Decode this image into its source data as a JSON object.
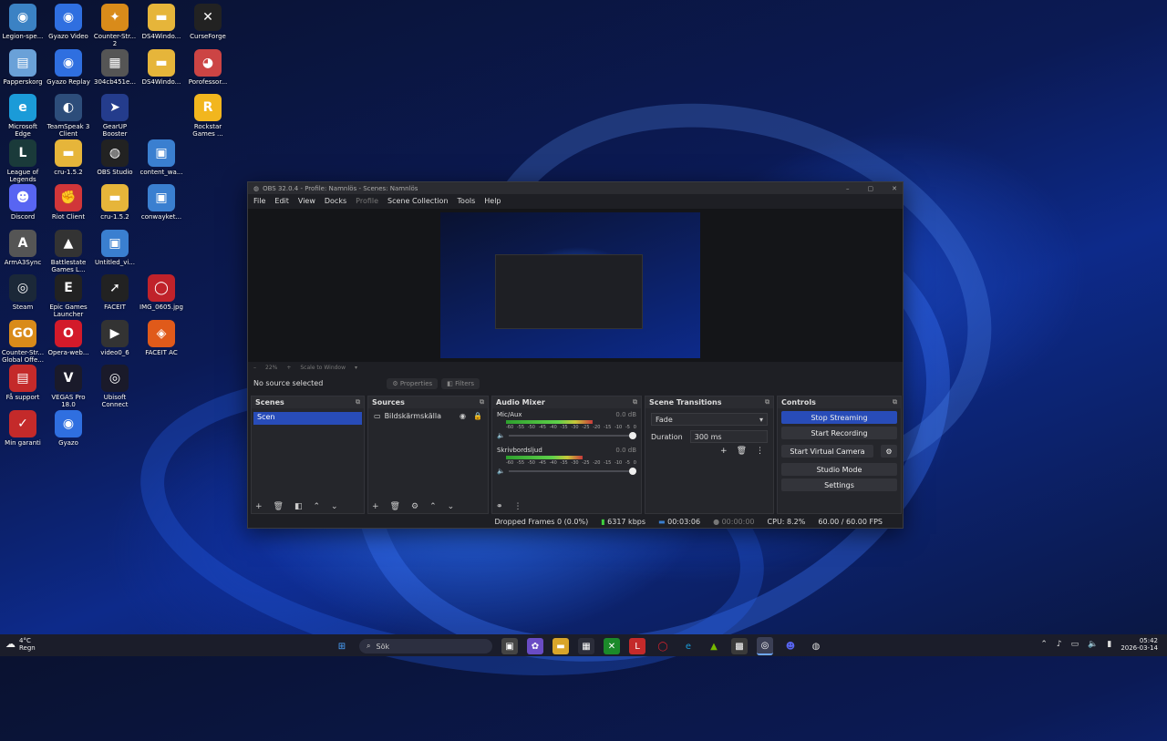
{
  "desktop": {
    "icons": [
      {
        "label": "Legion-spe...",
        "glyph": "◉",
        "color": "#3b82c4"
      },
      {
        "label": "Gyazo Video",
        "glyph": "◉",
        "color": "#2f6fe0"
      },
      {
        "label": "Counter-Str... 2",
        "glyph": "✦",
        "color": "#d98b1a"
      },
      {
        "label": "DS4Windo...",
        "glyph": "▬",
        "color": "#e6b53a"
      },
      {
        "label": "CurseForge",
        "glyph": "✕",
        "color": "#222"
      },
      {
        "label": "Papperskorg",
        "glyph": "▤",
        "color": "#6aa1d8"
      },
      {
        "label": "Gyazo Replay",
        "glyph": "◉",
        "color": "#2f6fe0"
      },
      {
        "label": "304cb451e...",
        "glyph": "▦",
        "color": "#555"
      },
      {
        "label": "DS4Windo...",
        "glyph": "▬",
        "color": "#e6b53a"
      },
      {
        "label": "Porofessor...",
        "glyph": "◕",
        "color": "#c44"
      },
      {
        "label": "Microsoft Edge",
        "glyph": "e",
        "color": "#1b9bd8"
      },
      {
        "label": "TeamSpeak 3 Client",
        "glyph": "◐",
        "color": "#2d4d7a"
      },
      {
        "label": "GearUP Booster",
        "glyph": "➤",
        "color": "#243c8c"
      },
      {
        "label": "Rockstar Games ...",
        "glyph": "R",
        "color": "#f2b61e"
      },
      {
        "label": "League of Legends",
        "glyph": "L",
        "color": "#1a3a3a"
      },
      {
        "label": "cru-1.5.2",
        "glyph": "▬",
        "color": "#e6b53a"
      },
      {
        "label": "OBS Studio",
        "glyph": "◍",
        "color": "#222"
      },
      {
        "label": "content_wa...",
        "glyph": "▣",
        "color": "#3a7fd0"
      },
      {
        "label": "Discord",
        "glyph": "☻",
        "color": "#5865f2"
      },
      {
        "label": "Riot Client",
        "glyph": "✊",
        "color": "#d13639"
      },
      {
        "label": "cru-1.5.2",
        "glyph": "▬",
        "color": "#e6b53a"
      },
      {
        "label": "conwayket...",
        "glyph": "▣",
        "color": "#3a7fd0"
      },
      {
        "label": "ArmA3Sync",
        "glyph": "A",
        "color": "#555"
      },
      {
        "label": "Battlestate Games L...",
        "glyph": "▲",
        "color": "#333"
      },
      {
        "label": "Untitled_vi...",
        "glyph": "▣",
        "color": "#3a7fd0"
      },
      {
        "label": "Steam",
        "glyph": "◎",
        "color": "#1b2838"
      },
      {
        "label": "Epic Games Launcher",
        "glyph": "E",
        "color": "#222"
      },
      {
        "label": "FACEIT",
        "glyph": "➚",
        "color": "#222"
      },
      {
        "label": "IMG_0605.jpg",
        "glyph": "◯",
        "color": "#c0222a"
      },
      {
        "label": "Counter-Str... Global Offe...",
        "glyph": "GO",
        "color": "#d98b1a"
      },
      {
        "label": "Opera-web...",
        "glyph": "O",
        "color": "#d31a2a"
      },
      {
        "label": "video0_6",
        "glyph": "▶",
        "color": "#333"
      },
      {
        "label": "FACEIT AC",
        "glyph": "◈",
        "color": "#e05a1a"
      },
      {
        "label": "Få support",
        "glyph": "▤",
        "color": "#c42a2a"
      },
      {
        "label": "VEGAS Pro 18.0",
        "glyph": "V",
        "color": "#1a1a2a"
      },
      {
        "label": "Ubisoft Connect",
        "glyph": "◎",
        "color": "#1a1a2a"
      },
      {
        "label": "Min garanti",
        "glyph": "✓",
        "color": "#c42a2a"
      },
      {
        "label": "Gyazo",
        "glyph": "◉",
        "color": "#2f6fe0"
      }
    ]
  },
  "obs": {
    "title": "OBS 32.0.4 - Profile: Namnlös - Scenes: Namnlös",
    "menu": [
      "File",
      "Edit",
      "View",
      "Docks",
      "Profile",
      "Scene Collection",
      "Tools",
      "Help"
    ],
    "zoom": "22%",
    "scale_mode": "Scale to Window",
    "no_source": "No source selected",
    "properties": "Properties",
    "filters": "Filters",
    "scenes": {
      "title": "Scenes",
      "items": [
        "Scen"
      ]
    },
    "sources": {
      "title": "Sources",
      "items": [
        "Bildskärmskälla"
      ]
    },
    "mixer": {
      "title": "Audio Mixer",
      "channels": [
        {
          "name": "Mic/Aux",
          "db": "0.0 dB",
          "level": 0.62
        },
        {
          "name": "Skrivbordsljud",
          "db": "0.0 dB",
          "level": 0.55
        }
      ],
      "scale": [
        "-60",
        "-55",
        "-50",
        "-45",
        "-40",
        "-35",
        "-30",
        "-25",
        "-20",
        "-15",
        "-10",
        "-5",
        "0"
      ]
    },
    "transitions": {
      "title": "Scene Transitions",
      "type": "Fade",
      "duration_label": "Duration",
      "duration": "300 ms"
    },
    "controls": {
      "title": "Controls",
      "stop_streaming": "Stop Streaming",
      "start_recording": "Start Recording",
      "start_virtual_camera": "Start Virtual Camera",
      "studio_mode": "Studio Mode",
      "settings": "Settings"
    },
    "status": {
      "dropped": "Dropped Frames 0 (0.0%)",
      "bitrate": "6317 kbps",
      "stream_time": "00:03:06",
      "rec_time": "00:00:00",
      "cpu": "CPU: 8.2%",
      "fps": "60.00 / 60.00 FPS"
    }
  },
  "taskbar": {
    "weather_temp": "4°C",
    "weather_desc": "Regn",
    "search_placeholder": "Sök",
    "time": "05:42",
    "date": "2026-03-14"
  }
}
